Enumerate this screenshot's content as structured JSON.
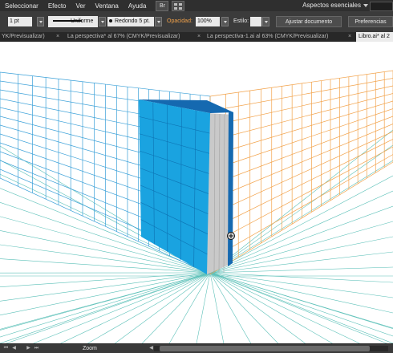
{
  "menu": {
    "items": [
      "Seleccionar",
      "Efecto",
      "Ver",
      "Ventana",
      "Ayuda"
    ],
    "bridge_label": "Br",
    "workspace": "Aspectos esenciales"
  },
  "control_bar": {
    "stroke_weight": "1 pt",
    "stroke_profile": "Uniforme",
    "brush": "Redondo 5 pt.",
    "opacity_label": "Opacidad:",
    "opacity_value": "100%",
    "style_label": "Estilo:",
    "doc_setup_button": "Ajustar documento",
    "prefs_button": "Preferencias"
  },
  "tabs": [
    {
      "label": "YK/Previsualizar)",
      "active": false
    },
    {
      "label": "La perspectiva* al 67% (CMYK/Previsualizar)",
      "active": false
    },
    {
      "label": "La perspectiva-1.ai al 63% (CMYK/Previsualizar)",
      "active": false
    },
    {
      "label": "Libro.ai* al 2",
      "active": true
    }
  ],
  "status": {
    "zoom_label": "Zoom"
  },
  "colors": {
    "left_grid": "#3aa0d8",
    "right_grid": "#f2a24a",
    "ground_grid": "#5bc0b8",
    "book_front": "#1aa3e0",
    "book_spine": "#1569b0",
    "book_pages": "#c9c9c9"
  }
}
